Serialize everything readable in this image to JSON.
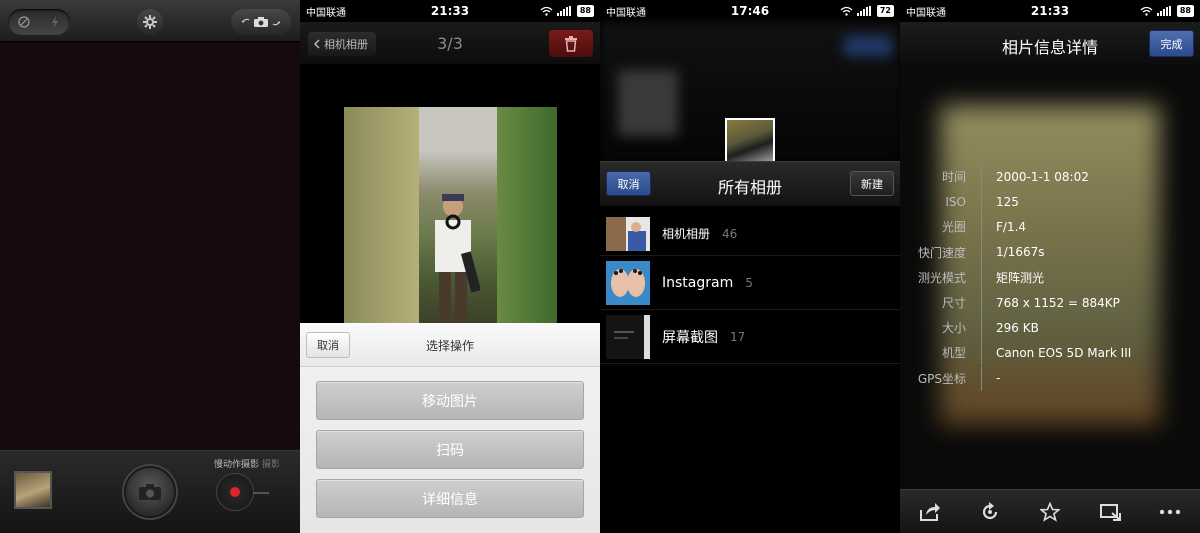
{
  "status": {
    "carrier": "中国联通",
    "panel2_time": "21:33",
    "panel3_time": "17:46",
    "panel4_time": "21:33",
    "panel2_battery": "88",
    "panel3_battery": "72",
    "panel4_battery": "88"
  },
  "camera": {
    "mode_label": "慢动作摄影",
    "mode_label_alt": "摄影",
    "record_color": "#e0242c"
  },
  "viewer": {
    "back_label": "相机相册",
    "counter": "3/3",
    "sheet_title": "选择操作",
    "cancel_label": "取消",
    "actions": [
      "移动图片",
      "扫码",
      "详细信息"
    ]
  },
  "album_picker": {
    "title": "所有相册",
    "cancel_label": "取消",
    "new_label": "新建",
    "albums": [
      {
        "name": "相机相册",
        "count": "46"
      },
      {
        "name": "Instagram",
        "count": "5"
      },
      {
        "name": "屏幕截图",
        "count": "17"
      }
    ]
  },
  "photo_info": {
    "title": "相片信息详情",
    "done_label": "完成",
    "rows": [
      {
        "label": "时间",
        "value": "2000-1-1 08:02"
      },
      {
        "label": "ISO",
        "value": "125"
      },
      {
        "label": "光圈",
        "value": "F/1.4"
      },
      {
        "label": "快门速度",
        "value": "1/1667s"
      },
      {
        "label": "测光模式",
        "value": "矩阵测光"
      },
      {
        "label": "尺寸",
        "value": "768 x 1152 = 884KP"
      },
      {
        "label": "大小",
        "value": "296 KB"
      },
      {
        "label": "机型",
        "value": "Canon EOS 5D Mark III"
      },
      {
        "label": "GPS坐标",
        "value": "-"
      }
    ],
    "toolbar_icons": [
      "share-icon",
      "rotate-icon",
      "star-icon",
      "crop-icon",
      "more-icon"
    ]
  },
  "colors": {
    "accent_blue": "#2b4b8c",
    "delete_red": "#7b1a1a"
  }
}
